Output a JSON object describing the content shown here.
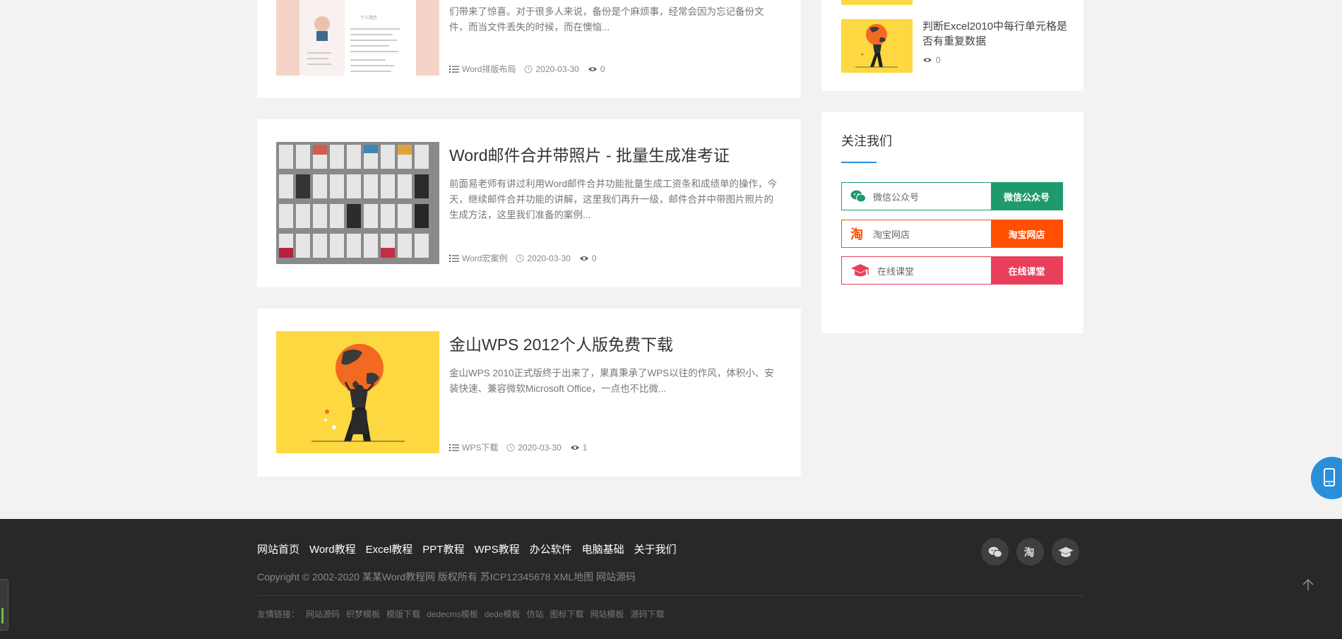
{
  "articles": [
    {
      "desc": "们带来了惊喜。对于很多人来说，备份是个麻烦事，经常会因为忘记备份文件，而当文件丢失的时候，而在懊恼...",
      "category": "Word排版布局",
      "date": "2020-03-30",
      "views": "0",
      "thumb_text": "个人简历"
    },
    {
      "title": "Word邮件合并带照片 - 批量生成准考证",
      "desc": "前面易老师有讲过利用Word邮件合并功能批量生成工资条和成绩单的操作，今天，继续邮件合并功能的讲解，这里我们再升一级，邮件合并中带图片照片的生成方法，这里我们准备的案例...",
      "category": "Word宏案例",
      "date": "2020-03-30",
      "views": "0"
    },
    {
      "title": "金山WPS 2012个人版免费下载",
      "desc": "金山WPS 2010正式版终于出来了，果真秉承了WPS以往的作风，体积小、安装快速、兼容微软Microsoft Office，一点也不比微...",
      "category": "WPS下载",
      "date": "2020-03-30",
      "views": "1"
    }
  ],
  "sidebar": {
    "related": {
      "title": "判断Excel2010中每行单元格是否有重复数据",
      "views": "0"
    },
    "follow": {
      "heading": "关注我们",
      "items": [
        {
          "label": "微信公众号",
          "button": "微信公众号",
          "color": "#1f9a6c",
          "icon": "wechat-icon"
        },
        {
          "label": "淘宝网店",
          "button": "淘宝网店",
          "color": "#ff4f00",
          "icon": "taobao-icon"
        },
        {
          "label": "在线课堂",
          "button": "在线课堂",
          "color": "#e93f5b",
          "icon": "graduation-cap-icon"
        }
      ]
    }
  },
  "footer": {
    "nav": [
      "网站首页",
      "Word教程",
      "Excel教程",
      "PPT教程",
      "WPS教程",
      "办公软件",
      "电脑基础",
      "关于我们"
    ],
    "copyright": "Copyright © 2002-2020 某某Word教程网 版权所有 苏ICP12345678 XML地图 网站源码",
    "friends_label": "友情链接：",
    "friends": [
      "网站源码",
      "织梦模板",
      "模版下载",
      "dedecms模板",
      "dede模板",
      "仿站",
      "图标下载",
      "网站模板",
      "源码下载"
    ],
    "icons": [
      "wechat-icon",
      "taobao-icon",
      "graduation-cap-icon"
    ]
  }
}
